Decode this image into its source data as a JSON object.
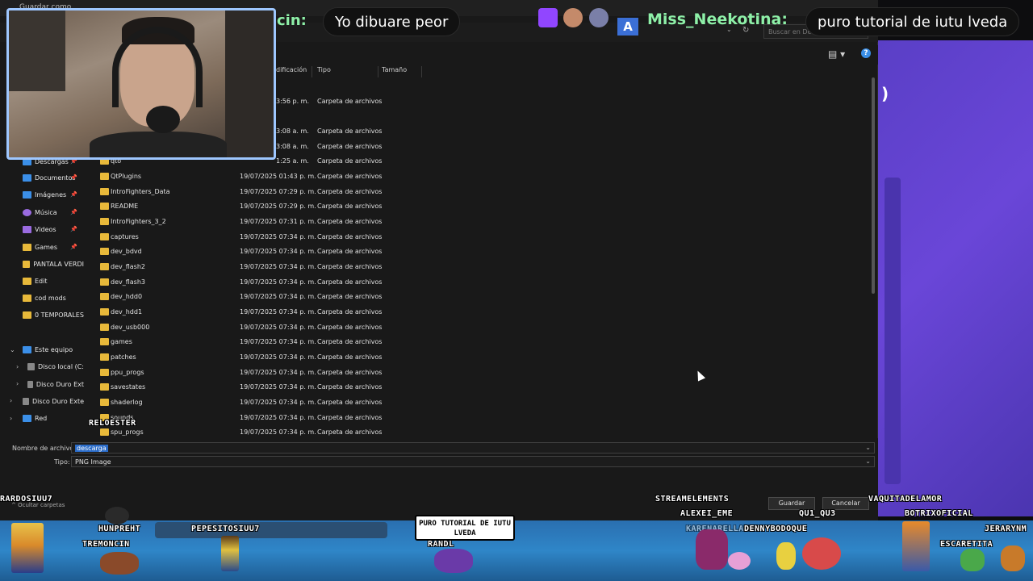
{
  "window": {
    "title": "Guardar como"
  },
  "search": {
    "placeholder": "Buscar en Des"
  },
  "columns": [
    "dificación",
    "Tipo",
    "Tamaño"
  ],
  "nav": [
    {
      "label": "Descargas",
      "icon": "download-icon"
    },
    {
      "label": "Documentos",
      "icon": "document-icon"
    },
    {
      "label": "Imágenes",
      "icon": "image-icon"
    },
    {
      "label": "Música",
      "icon": "music-icon"
    },
    {
      "label": "Videos",
      "icon": "video-icon"
    },
    {
      "label": "Games",
      "icon": "folder-icon"
    },
    {
      "label": "PANTALA VERDI",
      "icon": "folder-icon"
    },
    {
      "label": "Edit",
      "icon": "folder-icon"
    },
    {
      "label": "cod mods",
      "icon": "folder-icon"
    },
    {
      "label": "0 TEMPORALES",
      "icon": "folder-icon"
    },
    {
      "label": "Este equipo",
      "icon": "computer-icon"
    },
    {
      "label": "Disco local (C:",
      "icon": "drive-icon"
    },
    {
      "label": "Disco Duro Ext",
      "icon": "drive-icon"
    },
    {
      "label": "Disco Duro Exte",
      "icon": "drive-icon"
    },
    {
      "label": "Red",
      "icon": "network-icon"
    }
  ],
  "files": [
    {
      "name": "",
      "date": "3:56 p. m.",
      "type": "Carpeta de archivos"
    },
    {
      "name": "",
      "date": "3:08 a. m.",
      "type": "Carpeta de archivos"
    },
    {
      "name": "",
      "date": "3:08 a. m.",
      "type": "Carpeta de archivos"
    },
    {
      "name": "qto",
      "date": "1:25 a. m.",
      "type": "Carpeta de archivos"
    },
    {
      "name": "QtPlugins",
      "date": "19/07/2025 01:43 p. m.",
      "type": "Carpeta de archivos"
    },
    {
      "name": "IntroFighters_Data",
      "date": "19/07/2025 07:29 p. m.",
      "type": "Carpeta de archivos"
    },
    {
      "name": "README",
      "date": "19/07/2025 07:29 p. m.",
      "type": "Carpeta de archivos"
    },
    {
      "name": "IntroFighters_3_2",
      "date": "19/07/2025 07:31 p. m.",
      "type": "Carpeta de archivos"
    },
    {
      "name": "captures",
      "date": "19/07/2025 07:34 p. m.",
      "type": "Carpeta de archivos"
    },
    {
      "name": "dev_bdvd",
      "date": "19/07/2025 07:34 p. m.",
      "type": "Carpeta de archivos"
    },
    {
      "name": "dev_flash2",
      "date": "19/07/2025 07:34 p. m.",
      "type": "Carpeta de archivos"
    },
    {
      "name": "dev_flash3",
      "date": "19/07/2025 07:34 p. m.",
      "type": "Carpeta de archivos"
    },
    {
      "name": "dev_hdd0",
      "date": "19/07/2025 07:34 p. m.",
      "type": "Carpeta de archivos"
    },
    {
      "name": "dev_hdd1",
      "date": "19/07/2025 07:34 p. m.",
      "type": "Carpeta de archivos"
    },
    {
      "name": "dev_usb000",
      "date": "19/07/2025 07:34 p. m.",
      "type": "Carpeta de archivos"
    },
    {
      "name": "games",
      "date": "19/07/2025 07:34 p. m.",
      "type": "Carpeta de archivos"
    },
    {
      "name": "patches",
      "date": "19/07/2025 07:34 p. m.",
      "type": "Carpeta de archivos"
    },
    {
      "name": "ppu_progs",
      "date": "19/07/2025 07:34 p. m.",
      "type": "Carpeta de archivos"
    },
    {
      "name": "savestates",
      "date": "19/07/2025 07:34 p. m.",
      "type": "Carpeta de archivos"
    },
    {
      "name": "shaderlog",
      "date": "19/07/2025 07:34 p. m.",
      "type": "Carpeta de archivos"
    },
    {
      "name": "sounds",
      "date": "19/07/2025 07:34 p. m.",
      "type": "Carpeta de archivos"
    },
    {
      "name": "spu_progs",
      "date": "19/07/2025 07:34 p. m.",
      "type": "Carpeta de archivos"
    }
  ],
  "form": {
    "filename_label": "Nombre de archivo:",
    "filename_value": "descarga",
    "type_label": "Tipo:",
    "type_value": "PNG Image",
    "save_label": "Guardar",
    "cancel_label": "Cancelar",
    "hide_folders": "Ocultar carpetas"
  },
  "chat": {
    "user1": "cin:",
    "msg1": "Yo dibuare peor",
    "user2": "Miss_Neekotina:",
    "msg2": "puro tutorial de iutu lveda",
    "badge_letter": "A"
  },
  "overlay_names": {
    "relodester": "RELOESTER",
    "rardosiuu7": "RARDOSIUU7",
    "hunpreht": "HUNPREHT",
    "pepesitosiuu7": "PEPESITOSIUU7",
    "tremoncin": "TREMONCIN",
    "randl": "RANDL",
    "streamelements": "STREAMELEMENTS",
    "alexei": "ALEXEI_EME",
    "qu1qu3": "QU1_QU3",
    "karen": "KARENARELLANO",
    "dennybodoque": "DENNYBODOQUE",
    "vaquita": "VAQUITADELAMOR",
    "botrix": "BOTRIXOFICIAL",
    "jerarynm": "JERARYNM",
    "escaretita": "ESCARETITA"
  },
  "speech": "PURO TUTORIAL DE IUTU LVEDA"
}
